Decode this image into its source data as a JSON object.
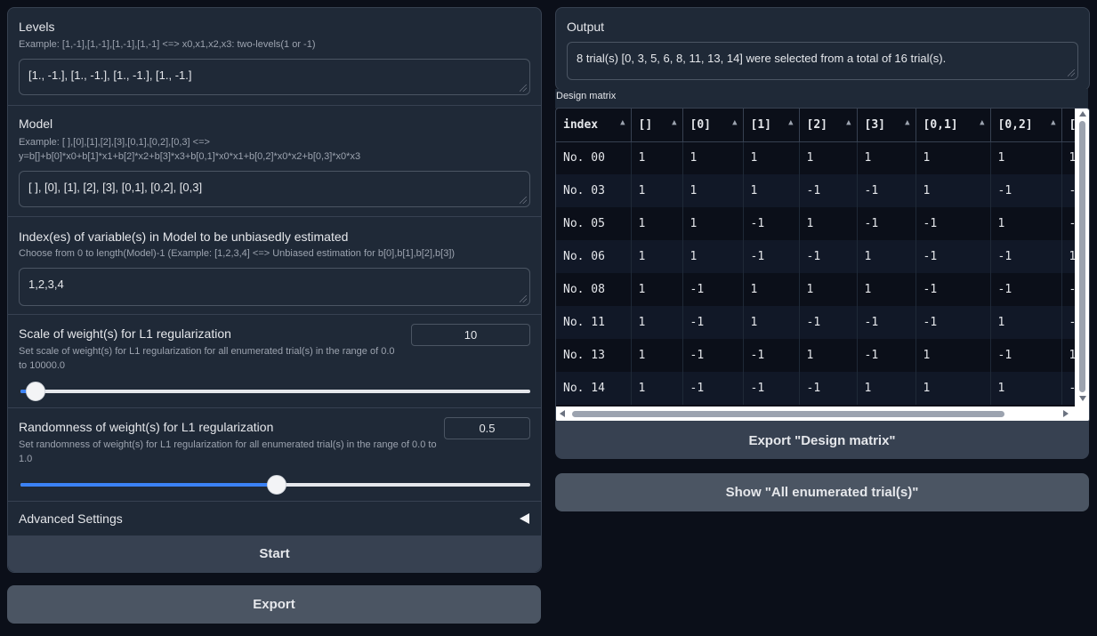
{
  "levels": {
    "label": "Levels",
    "info": "Example: [1,-1],[1,-1],[1,-1],[1,-1] <=> x0,x1,x2,x3: two-levels(1 or -1)",
    "value": "[1., -1.], [1., -1.], [1., -1.], [1., -1.]"
  },
  "model": {
    "label": "Model",
    "info1": "Example: [ ],[0],[1],[2],[3],[0,1],[0,2],[0,3] <=>",
    "info2": "y=b[]+b[0]*x0+b[1]*x1+b[2]*x2+b[3]*x3+b[0,1]*x0*x1+b[0,2]*x0*x2+b[0,3]*x0*x3",
    "value": "[ ], [0], [1], [2], [3], [0,1], [0,2], [0,3]"
  },
  "unbiased": {
    "label": "Index(es) of variable(s) in Model to be unbiasedly estimated",
    "info": "Choose from 0 to length(Model)-1 (Example: [1,2,3,4] <=> Unbiased estimation for b[0],b[1],b[2],b[3])",
    "value": "1,2,3,4"
  },
  "scale": {
    "label": "Scale of weight(s) for L1 regularization",
    "info1": "Set scale of weight(s) for L1 regularization for all enumerated trial(s) in the range of 0.0",
    "info2": "to 10000.0",
    "value": "10",
    "fraction": 0.001
  },
  "randomness": {
    "label": "Randomness of weight(s) for L1 regularization",
    "info1": "Set randomness of weight(s) for L1 regularization for all enumerated trial(s) in the range of 0.0 to",
    "info2": "1.0",
    "value": "0.5",
    "fraction": 0.5
  },
  "advanced": {
    "label": "Advanced Settings",
    "icon": "triangle-left-icon"
  },
  "buttons": {
    "start": "Start",
    "export": "Export",
    "export_design": "Export \"Design matrix\"",
    "show_all": "Show \"All enumerated trial(s)\""
  },
  "output": {
    "label": "Output",
    "value": "8 trial(s) [0, 3, 5, 6, 8, 11, 13, 14] were selected from a total of 16 trial(s)."
  },
  "design_matrix": {
    "label": "Design matrix",
    "columns": [
      "index",
      "[]",
      "[0]",
      "[1]",
      "[2]",
      "[3]",
      "[0,1]",
      "[0,2]",
      "["
    ],
    "rows": [
      [
        "No. 00",
        "1",
        "1",
        "1",
        "1",
        "1",
        "1",
        "1",
        "1"
      ],
      [
        "No. 03",
        "1",
        "1",
        "1",
        "-1",
        "-1",
        "1",
        "-1",
        "-"
      ],
      [
        "No. 05",
        "1",
        "1",
        "-1",
        "1",
        "-1",
        "-1",
        "1",
        "-"
      ],
      [
        "No. 06",
        "1",
        "1",
        "-1",
        "-1",
        "1",
        "-1",
        "-1",
        "1"
      ],
      [
        "No. 08",
        "1",
        "-1",
        "1",
        "1",
        "1",
        "-1",
        "-1",
        "-"
      ],
      [
        "No. 11",
        "1",
        "-1",
        "1",
        "-1",
        "-1",
        "-1",
        "1",
        "-"
      ],
      [
        "No. 13",
        "1",
        "-1",
        "-1",
        "1",
        "-1",
        "1",
        "-1",
        "1"
      ],
      [
        "No. 14",
        "1",
        "-1",
        "-1",
        "-1",
        "1",
        "1",
        "1",
        "-"
      ]
    ]
  }
}
